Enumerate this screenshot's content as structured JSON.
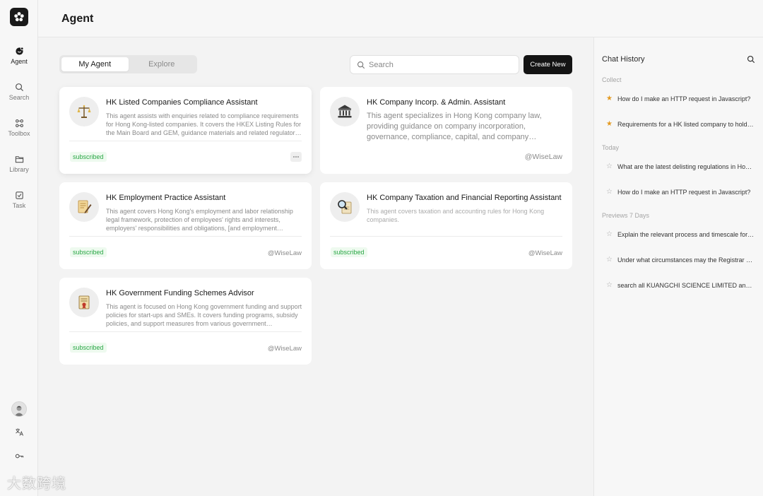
{
  "app": {
    "page_title": "Agent"
  },
  "rail": {
    "items": [
      {
        "label": "Agent",
        "icon": "agent-icon",
        "active": true
      },
      {
        "label": "Search",
        "icon": "search-icon",
        "active": false
      },
      {
        "label": "Toolbox",
        "icon": "toolbox-icon",
        "active": false
      },
      {
        "label": "Library",
        "icon": "folder-icon",
        "active": false
      },
      {
        "label": "Task",
        "icon": "task-icon",
        "active": false
      }
    ],
    "bottom_icons": [
      "avatar",
      "translate-icon",
      "key-icon"
    ]
  },
  "tabs": [
    {
      "label": "My Agent",
      "active": true
    },
    {
      "label": "Explore",
      "active": false
    }
  ],
  "search": {
    "placeholder": "Search",
    "value": ""
  },
  "create_button": {
    "label": "Create New"
  },
  "cards": [
    {
      "title": "HK Listed Companies Compliance Assistant",
      "description": "This agent assists with enquiries related to compliance requirements for Hong Kong-listed companies. It covers the HKEX Listing Rules for the Main Board and GEM, guidance materials and related regulatory frameworks.",
      "icon": "scales-icon",
      "badge": "subscribed",
      "author": "",
      "has_more_menu": true
    },
    {
      "title": "HK Company Incorp. & Admin. Assistant",
      "description": "This agent specializes in Hong Kong company law, providing guidance on company incorporation, governance, compliance, capital, and company administration matters.",
      "icon": "bank-icon",
      "badge": "",
      "author": "@WiseLaw",
      "has_more_menu": false
    },
    {
      "title": "HK Employment Practice Assistant",
      "description": "This agent covers Hong Kong's employment and labor relationship legal framework, protection of employees' rights and interests, employers' responsibilities and obligations, [and employment practices].",
      "icon": "contract-icon",
      "badge": "subscribed",
      "author": "@WiseLaw",
      "has_more_menu": false
    },
    {
      "title": "HK Company Taxation and Financial Reporting Assistant",
      "description": "This agent covers taxation and accounting rules for Hong Kong companies.",
      "icon": "magnifier-document-icon",
      "badge": "subscribed",
      "author": "@WiseLaw",
      "has_more_menu": false
    },
    {
      "title": "HK Government Funding Schemes Advisor",
      "description": "This agent is focused on Hong Kong government funding and support policies for start-ups and SMEs. It covers funding programs, subsidy policies, and support measures from various government departments.",
      "icon": "certificate-icon",
      "badge": "subscribed",
      "author": "@WiseLaw",
      "has_more_menu": false
    }
  ],
  "chat_history": {
    "title": "Chat History",
    "sections": [
      {
        "label": "Collect",
        "items": [
          {
            "text": "How do I make an HTTP request in Javascript?",
            "starred": true
          },
          {
            "text": "Requirements for a HK listed company to hold its AGM",
            "starred": true
          }
        ]
      },
      {
        "label": "Today",
        "items": [
          {
            "text": "What are the latest delisting regulations in Hong Kong?",
            "starred": false
          },
          {
            "text": "How do I make an HTTP request in Javascript?",
            "starred": false
          }
        ]
      },
      {
        "label": "Previews 7 Days",
        "items": [
          {
            "text": "Explain the relevant process and timescale for the appointment",
            "starred": false
          },
          {
            "text": "Under what circumstances may the Registrar strike off a company",
            "starred": false
          },
          {
            "text": "search all KUANGCHI SCIENCE LIMITED announcements",
            "starred": false
          }
        ]
      }
    ]
  },
  "watermark": "大数跨境",
  "colors": {
    "accent": "#141414",
    "subscribed": "#29a745",
    "star": "#e39a21"
  }
}
